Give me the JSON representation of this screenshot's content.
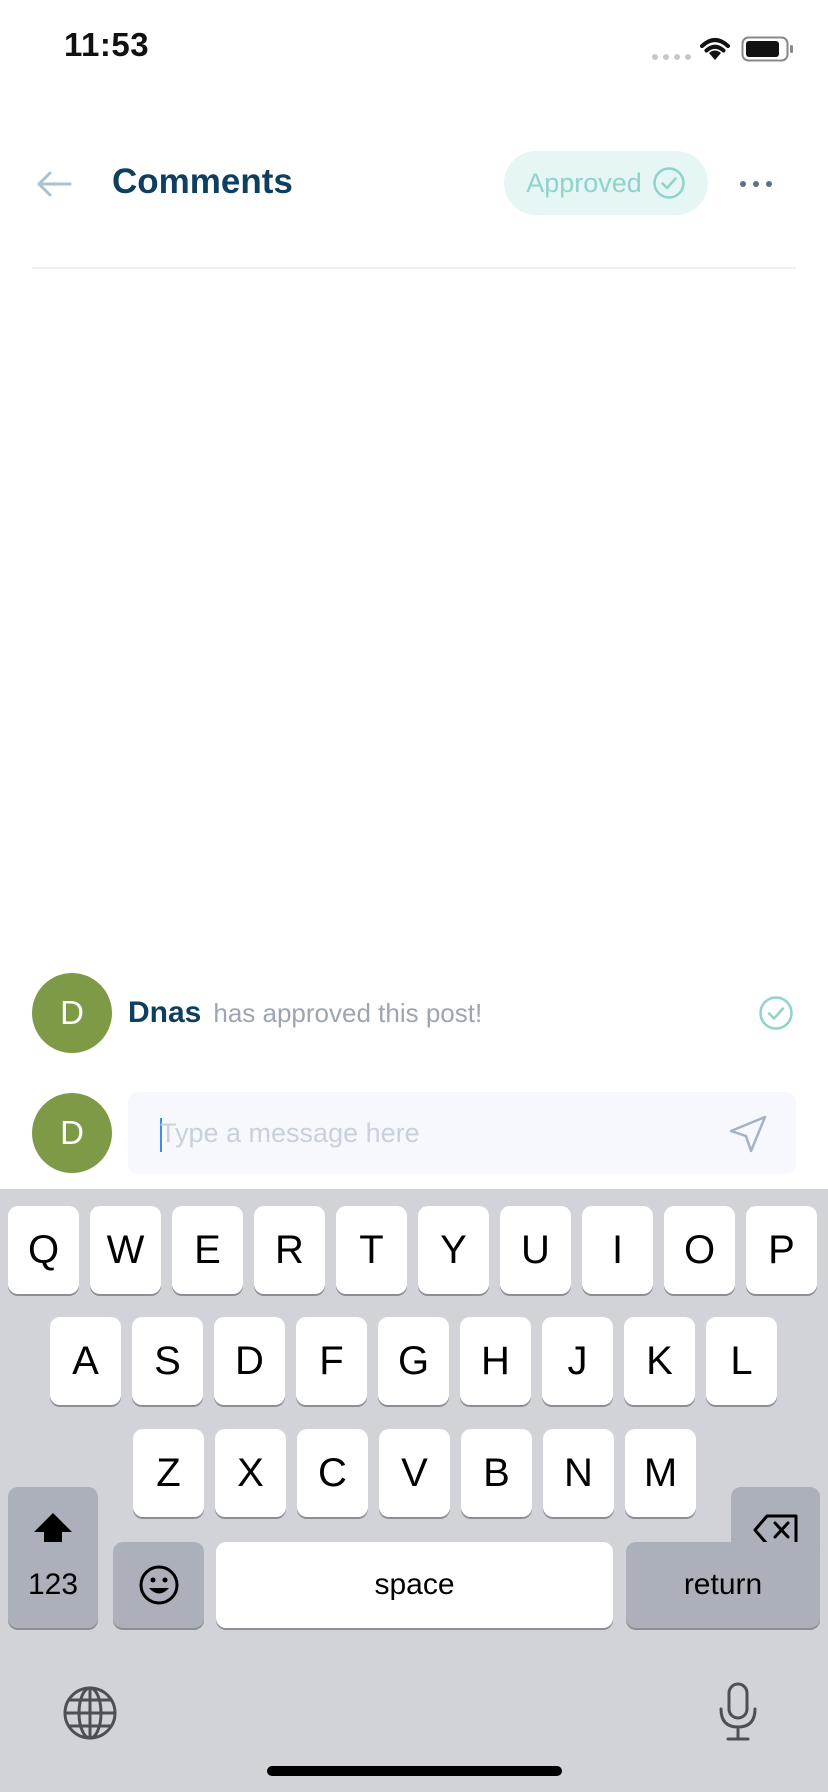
{
  "status_bar": {
    "time": "11:53"
  },
  "header": {
    "title": "Comments",
    "status_badge": "Approved"
  },
  "activity": {
    "avatar_initial": "D",
    "user": "Dnas",
    "message": "has approved this post!"
  },
  "composer": {
    "avatar_initial": "D",
    "placeholder": "Type a message here",
    "value": ""
  },
  "keyboard": {
    "row1": [
      "Q",
      "W",
      "E",
      "R",
      "T",
      "Y",
      "U",
      "I",
      "O",
      "P"
    ],
    "row2": [
      "A",
      "S",
      "D",
      "F",
      "G",
      "H",
      "J",
      "K",
      "L"
    ],
    "row3": [
      "Z",
      "X",
      "C",
      "V",
      "B",
      "N",
      "M"
    ],
    "numbers_label": "123",
    "space_label": "space",
    "return_label": "return"
  },
  "colors": {
    "title": "#0f3f5e",
    "accent_teal": "#8fd3cb",
    "badge_bg": "#e6f6f5",
    "avatar_green": "#7e9a47",
    "keyboard_bg": "#d1d3d9"
  }
}
